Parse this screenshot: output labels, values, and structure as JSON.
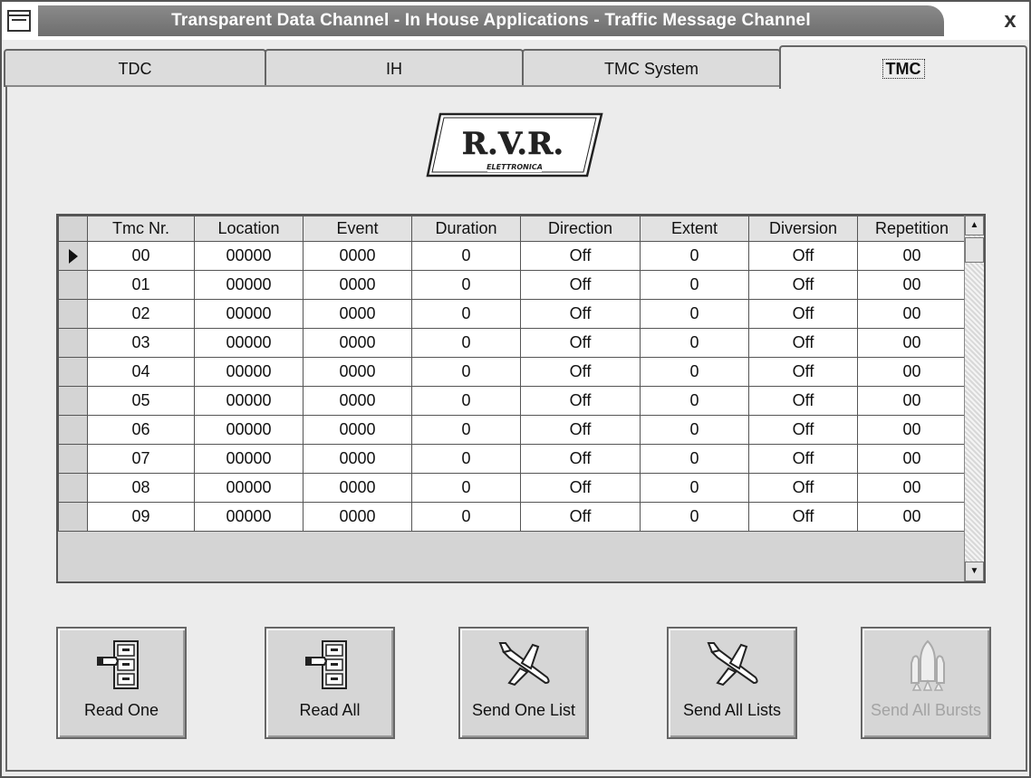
{
  "window": {
    "title": "Transparent Data Channel - In House Applications - Traffic Message Channel",
    "close_glyph": "x"
  },
  "tabs": [
    {
      "label": "TDC",
      "active": false
    },
    {
      "label": "IH",
      "active": false
    },
    {
      "label": "TMC System",
      "active": false
    },
    {
      "label": "TMC",
      "active": true
    }
  ],
  "logo": {
    "text": "R.V.R.",
    "subtext": "ELETTRONICA"
  },
  "table": {
    "columns": [
      "Tmc Nr.",
      "Location",
      "Event",
      "Duration",
      "Direction",
      "Extent",
      "Diversion",
      "Repetition"
    ],
    "rows": [
      [
        "00",
        "00000",
        "0000",
        "0",
        "Off",
        "0",
        "Off",
        "00"
      ],
      [
        "01",
        "00000",
        "0000",
        "0",
        "Off",
        "0",
        "Off",
        "00"
      ],
      [
        "02",
        "00000",
        "0000",
        "0",
        "Off",
        "0",
        "Off",
        "00"
      ],
      [
        "03",
        "00000",
        "0000",
        "0",
        "Off",
        "0",
        "Off",
        "00"
      ],
      [
        "04",
        "00000",
        "0000",
        "0",
        "Off",
        "0",
        "Off",
        "00"
      ],
      [
        "05",
        "00000",
        "0000",
        "0",
        "Off",
        "0",
        "Off",
        "00"
      ],
      [
        "06",
        "00000",
        "0000",
        "0",
        "Off",
        "0",
        "Off",
        "00"
      ],
      [
        "07",
        "00000",
        "0000",
        "0",
        "Off",
        "0",
        "Off",
        "00"
      ],
      [
        "08",
        "00000",
        "0000",
        "0",
        "Off",
        "0",
        "Off",
        "00"
      ],
      [
        "09",
        "00000",
        "0000",
        "0",
        "Off",
        "0",
        "Off",
        "00"
      ]
    ],
    "current_row": 0
  },
  "buttons": {
    "read_one": "Read One",
    "read_all": "Read All",
    "send_one_list": "Send One List",
    "send_all_lists": "Send All Lists",
    "send_all_bursts": "Send All Bursts"
  },
  "colors": {
    "title_bar": "#7a7a7a",
    "window_bg": "#ececec",
    "disabled_text": "#a3a3a3"
  }
}
